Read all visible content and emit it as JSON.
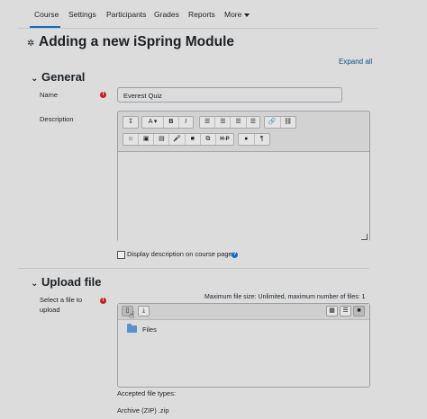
{
  "nav": {
    "tabs": [
      {
        "label": "Course",
        "active": true
      },
      {
        "label": "Settings"
      },
      {
        "label": "Participants"
      },
      {
        "label": "Grades"
      },
      {
        "label": "Reports"
      },
      {
        "label": "More"
      }
    ]
  },
  "page": {
    "title": "Adding a new iSpring Module",
    "expand_all": "Expand all"
  },
  "general": {
    "heading": "General",
    "name_label": "Name",
    "name_value": "Everest Quiz",
    "description_label": "Description",
    "display_desc_label": "Display description on course page"
  },
  "editor_toolbar": {
    "row1": [
      "↧",
      "A ▾",
      "B",
      "I",
      "☰",
      "☰",
      "☰",
      "☰",
      "🔗",
      "⛓"
    ],
    "row2": [
      "☺",
      "▣",
      "▤",
      "🎤",
      "■",
      "⧉",
      "H-P",
      "●",
      "¶"
    ]
  },
  "upload": {
    "heading": "Upload file",
    "select_label_line1": "Select a file to",
    "select_label_line2": "upload",
    "max_size": "Maximum file size: Unlimited, maximum number of files: 1",
    "folder_name": "Files",
    "accepted_types_label": "Accepted file types:",
    "accepted_type": "Archive (ZIP) .zip"
  },
  "colors": {
    "background": "#dcdcdc",
    "accent": "#0f6cbf",
    "required": "#c81e1e"
  }
}
